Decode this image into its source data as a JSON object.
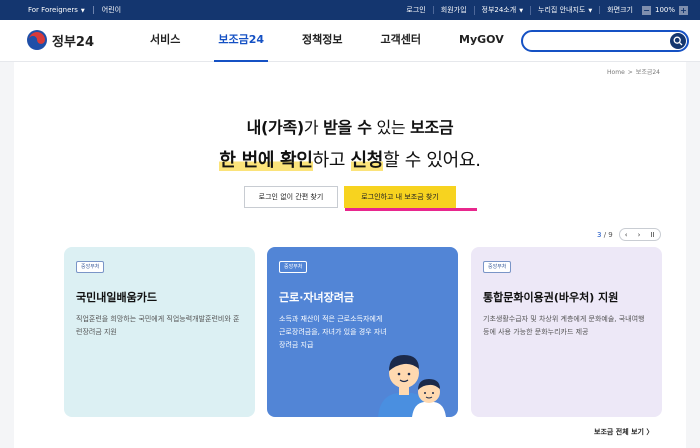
{
  "topbar": {
    "left": [
      "For Foreigners",
      "어린이"
    ],
    "right": [
      "로그인",
      "회원가입",
      "정부24소개",
      "누리집 안내지도",
      "화면크기"
    ],
    "zoom_minus": "−",
    "zoom_value": "100%",
    "zoom_plus": "+"
  },
  "header": {
    "logo_text": "정부24",
    "nav": [
      "서비스",
      "보조금24",
      "정책정보",
      "고객센터",
      "MyGOV"
    ],
    "search_placeholder": ""
  },
  "breadcrumb": [
    "Home",
    "보조금24"
  ],
  "hero": {
    "line1_a": "내(가족)",
    "line1_b": "가 ",
    "line1_c": "받을 수",
    "line1_d": " 있는 ",
    "line1_e": "보조금",
    "line2_a": "한 번에 확인",
    "line2_b": "하고 ",
    "line2_c": "신청",
    "line2_d": "할 수 있어요."
  },
  "buttons": {
    "guest": "로그인 없이 간편 찾기",
    "login": "로그인하고 내 보조금 찾기"
  },
  "pager": {
    "current": "3",
    "total": "/ 9",
    "prev": "‹",
    "next": "›",
    "pause": "II"
  },
  "cards": [
    {
      "tag": "중앙부처",
      "title": "국민내일배움카드",
      "desc": "직업훈련을 희망하는 국민에게 직업능력개발훈련비와 훈련장려금 지원"
    },
    {
      "tag": "중앙부처",
      "title": "근로·자녀장려금",
      "desc": "소득과 재산이 적은 근로소득자에게 근로장려금을, 자녀가 있을 경우 자녀장려금 지급"
    },
    {
      "tag": "중앙부처",
      "title": "통합문화이용권(바우처) 지원",
      "desc": "기초생활수급자 및 차상위 계층에게 문화예술, 국내여행 등에 사용 가능한 문화누리카드 제공"
    }
  ],
  "more_link": "보조금 전체 보기 〉"
}
